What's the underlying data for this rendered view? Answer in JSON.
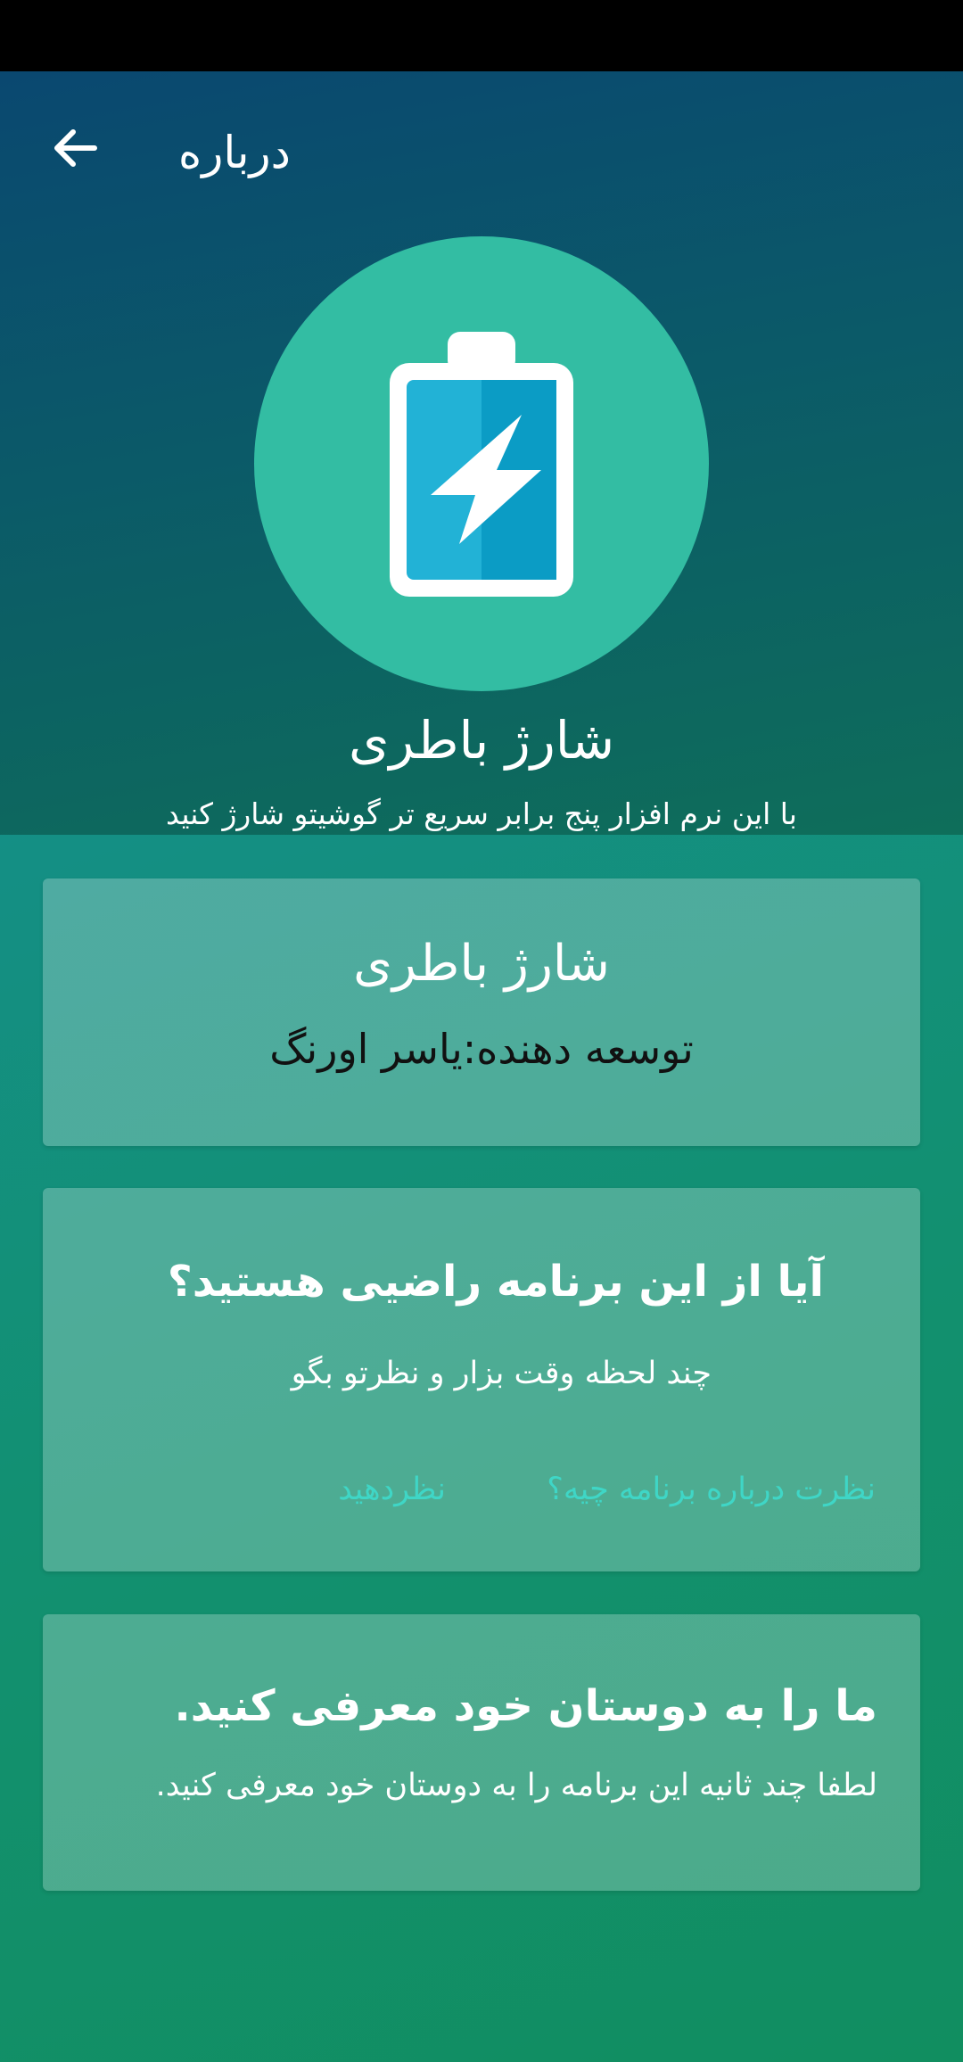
{
  "header": {
    "title": "درباره",
    "back_icon": "arrow-left-icon"
  },
  "hero": {
    "logo_icon": "battery-charging-icon",
    "app_name": "شارژ باطری",
    "tagline": "با این نرم افزار پنج برابر سریع تر گوشیتو شارژ کنید"
  },
  "info_card": {
    "title": "شارژ باطری",
    "developer": "توسعه دهنده:یاسر اورنگ"
  },
  "rate_card": {
    "title": "آیا از این برنامه راضیی هستید؟",
    "subtitle": "چند لحظه وقت بزار و نظرتو بگو",
    "feedback_label": "نظرت درباره برنامه چیه؟",
    "rate_label": "نظردهید"
  },
  "share_card": {
    "title": "ما را به دوستان خود معرفی کنید.",
    "subtitle": "لطفا چند ثانیه این برنامه را به دوستان خود معرفی کنید."
  },
  "colors": {
    "hero_top": "#0a4870",
    "logo_circle": "#33bda3",
    "battery_blue": "#22b2d6",
    "link": "#3fd6c6"
  }
}
